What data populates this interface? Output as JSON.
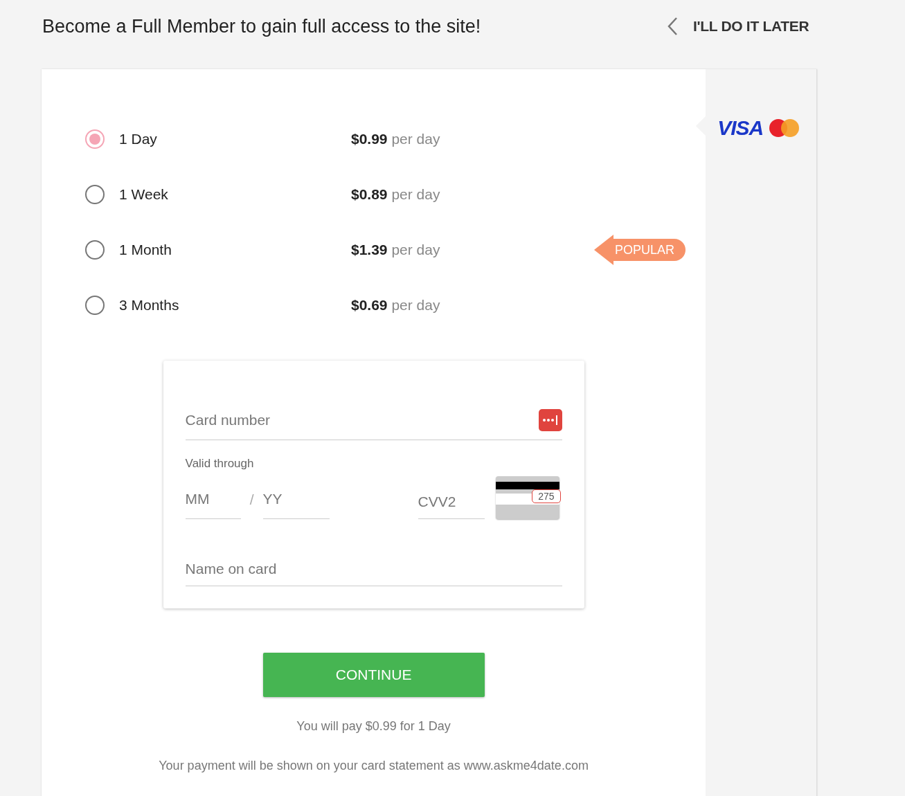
{
  "header": {
    "title": "Become a Full Member to gain full access to the site!",
    "skip_label": "I'LL DO IT LATER"
  },
  "plans": [
    {
      "label": "1 Day",
      "price": "$0.99",
      "unit": "per day",
      "selected": true,
      "popular": false
    },
    {
      "label": "1 Week",
      "price": "$0.89",
      "unit": "per day",
      "selected": false,
      "popular": false
    },
    {
      "label": "1 Month",
      "price": "$1.39",
      "unit": "per day",
      "selected": false,
      "popular": true
    },
    {
      "label": "3 Months",
      "price": "$0.69",
      "unit": "per day",
      "selected": false,
      "popular": false
    }
  ],
  "popular_badge": "POPULAR",
  "payment_brands": {
    "visa": "VISA"
  },
  "card_form": {
    "card_number": {
      "placeholder": "Card number"
    },
    "valid_through_label": "Valid through",
    "month": {
      "placeholder": "MM"
    },
    "separator": "/",
    "year": {
      "placeholder": "YY"
    },
    "cvv": {
      "placeholder": "CVV2"
    },
    "cvv_sample": "275",
    "name": {
      "placeholder": "Name on card"
    }
  },
  "continue_button": "CONTINUE",
  "summary": "You will pay $0.99 for 1 Day",
  "statement_note": "Your payment will be shown on your card statement as www.askme4date.com"
}
